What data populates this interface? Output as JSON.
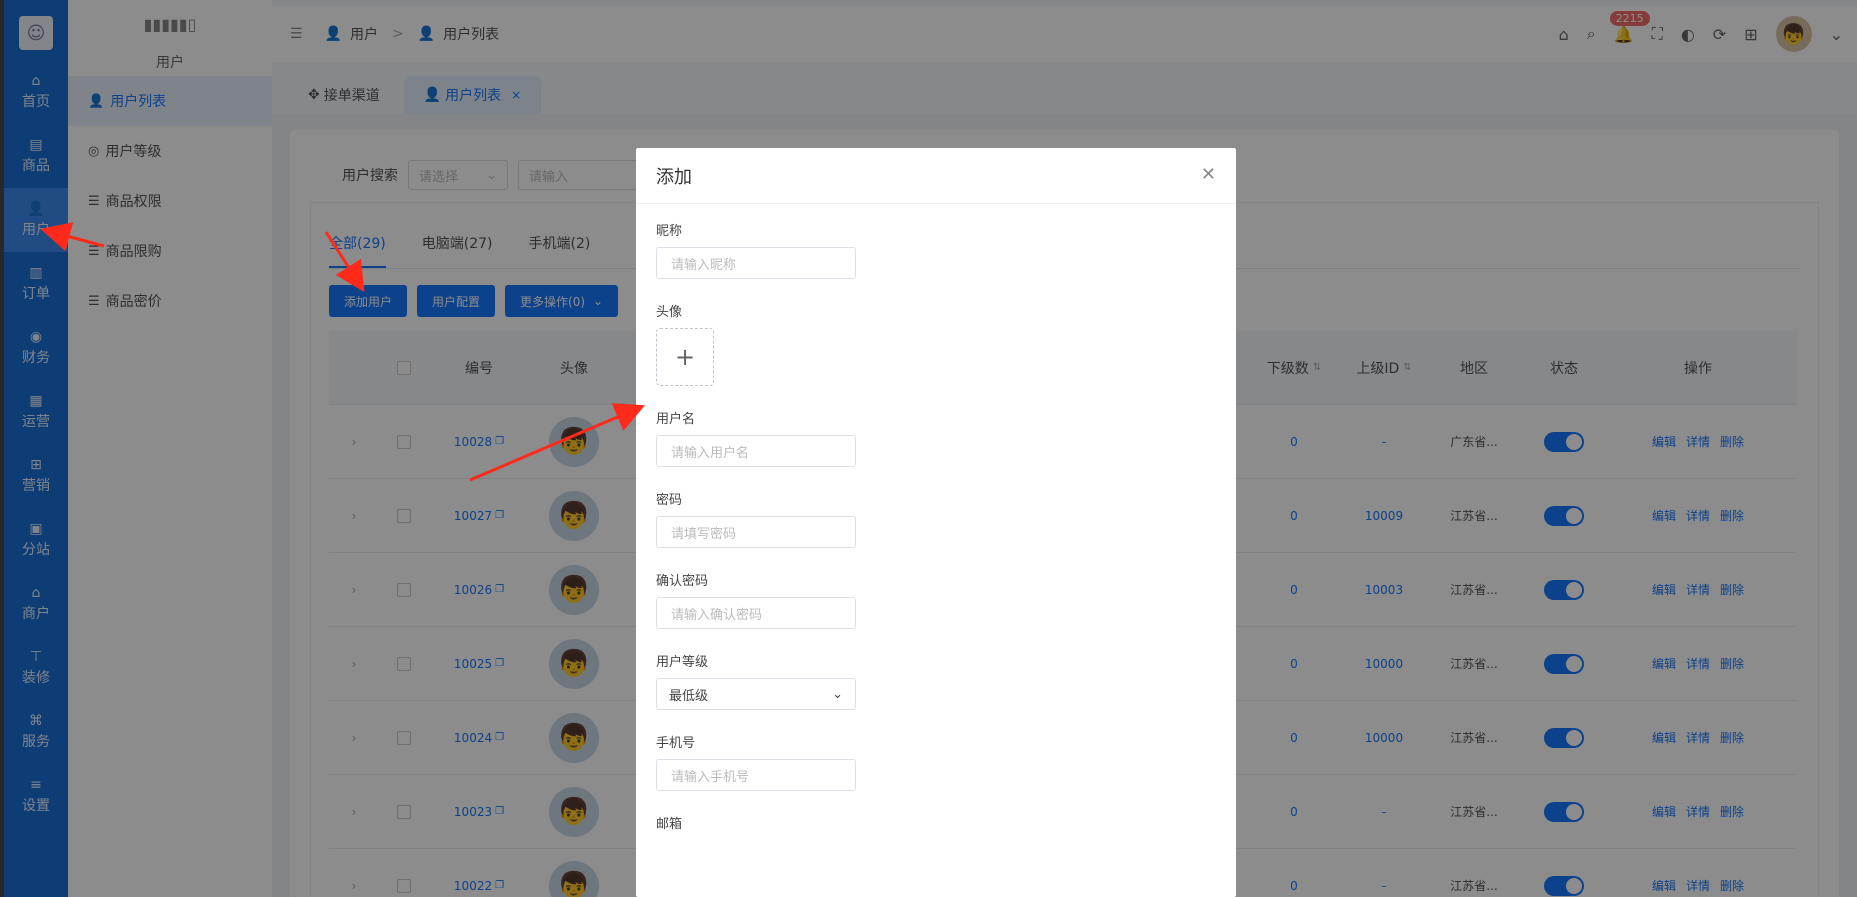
{
  "rail": {
    "items": [
      {
        "icon": "home-icon",
        "glyph": "⌂",
        "label": "首页"
      },
      {
        "icon": "goods-icon",
        "glyph": "▤",
        "label": "商品"
      },
      {
        "icon": "user-icon",
        "glyph": "👤",
        "label": "用户"
      },
      {
        "icon": "order-icon",
        "glyph": "▥",
        "label": "订单"
      },
      {
        "icon": "finance-icon",
        "glyph": "◉",
        "label": "财务"
      },
      {
        "icon": "ops-icon",
        "glyph": "▦",
        "label": "运营"
      },
      {
        "icon": "marketing-icon",
        "glyph": "⊞",
        "label": "营销"
      },
      {
        "icon": "branch-icon",
        "glyph": "▣",
        "label": "分站"
      },
      {
        "icon": "merchant-icon",
        "glyph": "⌂",
        "label": "商户"
      },
      {
        "icon": "decor-icon",
        "glyph": "⊤",
        "label": "装修"
      },
      {
        "icon": "service-icon",
        "glyph": "⌘",
        "label": "服务"
      },
      {
        "icon": "settings-icon",
        "glyph": "≡",
        "label": "设置"
      }
    ]
  },
  "side": {
    "section": "用户",
    "items": [
      {
        "label": "用户列表",
        "glyph": "👤"
      },
      {
        "label": "用户等级",
        "glyph": "◎"
      },
      {
        "label": "商品权限",
        "glyph": "☰"
      },
      {
        "label": "商品限购",
        "glyph": "☰"
      },
      {
        "label": "商品密价",
        "glyph": "☰"
      }
    ]
  },
  "header": {
    "breadcrumb_1": "用户",
    "breadcrumb_2": "用户列表",
    "badge_count": "2215"
  },
  "tabs": {
    "tab1": "接单渠道",
    "tab2": "用户列表"
  },
  "search": {
    "label": "用户搜索",
    "select_placeholder": "请选择",
    "input_placeholder": "请输入"
  },
  "subtabs": {
    "all": "全部(29)",
    "pc": "电脑端(27)",
    "mobile": "手机端(2)"
  },
  "buttons": {
    "add_user": "添加用户",
    "user_config": "用户配置",
    "more_ops": "更多操作(0)"
  },
  "table": {
    "headers": {
      "id": "编号",
      "avatar": "头像",
      "down": "下级数",
      "up": "上级ID",
      "region": "地区",
      "status": "状态",
      "ops": "操作"
    },
    "ops": {
      "edit": "编辑",
      "detail": "详情",
      "delete": "删除"
    },
    "rows": [
      {
        "id": "10028",
        "down": "0",
        "up": "-",
        "region": "广东省..."
      },
      {
        "id": "10027",
        "down": "0",
        "up": "10009",
        "region": "江苏省..."
      },
      {
        "id": "10026",
        "down": "0",
        "up": "10003",
        "region": "江苏省..."
      },
      {
        "id": "10025",
        "down": "0",
        "up": "10000",
        "region": "江苏省..."
      },
      {
        "id": "10024",
        "down": "0",
        "up": "10000",
        "region": "江苏省..."
      },
      {
        "id": "10023",
        "down": "0",
        "up": "-",
        "region": "江苏省..."
      },
      {
        "id": "10022",
        "down": "0",
        "up": "-",
        "region": "江苏省..."
      }
    ]
  },
  "modal": {
    "title": "添加",
    "nickname_label": "昵称",
    "nickname_placeholder": "请输入昵称",
    "avatar_label": "头像",
    "username_label": "用户名",
    "username_placeholder": "请输入用户名",
    "password_label": "密码",
    "password_placeholder": "请填写密码",
    "confirm_label": "确认密码",
    "confirm_placeholder": "请输入确认密码",
    "level_label": "用户等级",
    "level_value": "最低级",
    "phone_label": "手机号",
    "phone_placeholder": "请输入手机号",
    "email_label": "邮箱"
  },
  "colors": {
    "primary": "#1677ff",
    "rail": "#1a6fd8",
    "arrow": "#ff2a1a"
  }
}
